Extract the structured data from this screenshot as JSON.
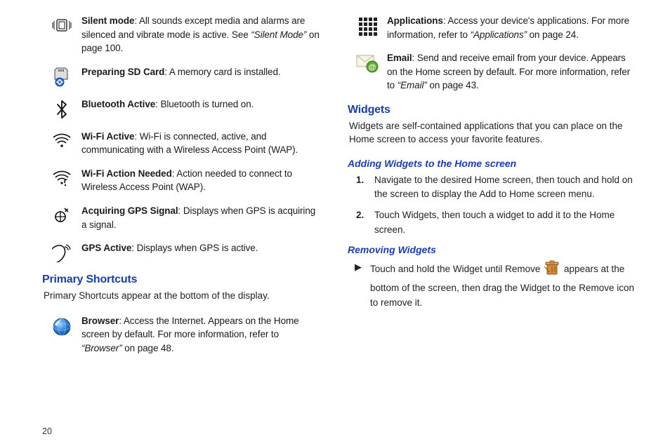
{
  "page_number": "20",
  "left": {
    "icons": [
      {
        "bold": "Silent mode",
        "rest": ": All sounds except media and alarms are silenced and vibrate mode is active. See ",
        "ref": "“Silent Mode”",
        "tail": " on page 100."
      },
      {
        "bold": "Preparing SD Card",
        "rest": ": A memory card is installed."
      },
      {
        "bold": "Bluetooth Active",
        "rest": ": Bluetooth is turned on."
      },
      {
        "bold": "Wi-Fi Active",
        "rest": ": Wi-Fi is connected, active, and communicating with a Wireless Access Point (WAP)."
      },
      {
        "bold": "Wi-Fi Action Needed",
        "rest": ": Action needed to connect to Wireless Access Point (WAP)."
      },
      {
        "bold": "Acquiring GPS Signal",
        "rest": ": Displays when GPS is acquiring a signal."
      },
      {
        "bold": "GPS Active",
        "rest": ": Displays when GPS is active."
      }
    ],
    "section_title": "Primary Shortcuts",
    "section_intro": "Primary Shortcuts appear at the bottom of the display.",
    "browser": {
      "bold": "Browser",
      "rest": ": Access the Internet. Appears on the Home screen by default. For more information, refer to ",
      "ref": "“Browser”",
      "tail": "  on page 48."
    }
  },
  "right": {
    "apps": {
      "bold": "Applications",
      "rest": ": Access your device's applications. For more information, refer to ",
      "ref": "“Applications”",
      "tail": "  on page 24."
    },
    "email": {
      "bold": "Email",
      "rest": ": Send and receive email from your device. Appears on the Home screen by default. For more information, refer to ",
      "ref": "“Email”",
      "tail": "  on page 43."
    },
    "widgets_title": "Widgets",
    "widgets_intro": "Widgets are self-contained applications that you can place on the Home screen to access your favorite features.",
    "adding_title": "Adding Widgets to the Home screen",
    "adding_steps": [
      {
        "pre": "Navigate to the desired Home screen, then touch and hold on the screen to display the ",
        "bold": "Add to Home screen",
        "post": " menu."
      },
      {
        "pre": "Touch ",
        "bold": "Widgets",
        "post": ", then touch a widget to add it to the Home screen."
      }
    ],
    "removing_title": "Removing Widgets",
    "removing": {
      "pre": "Touch and hold the Widget until ",
      "bold1": "Remove",
      "mid": " appears at the bottom of the screen, then drag the Widget to the ",
      "bold2": "Remove",
      "post": " icon to remove it."
    }
  }
}
